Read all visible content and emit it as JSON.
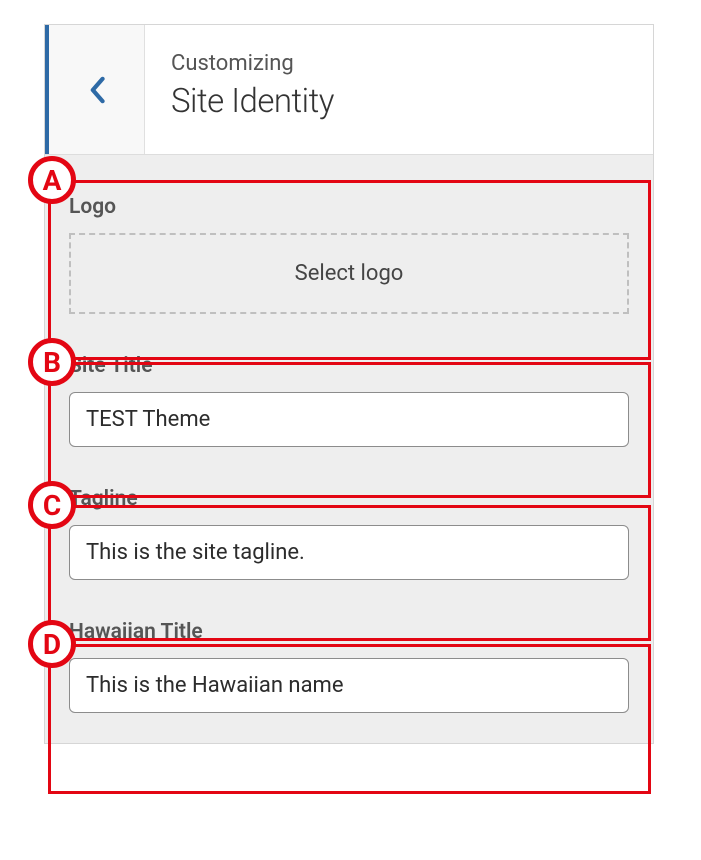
{
  "header": {
    "context_label": "Customizing",
    "section_title": "Site Identity"
  },
  "logo": {
    "label": "Logo",
    "button_text": "Select logo"
  },
  "site_title": {
    "label": "Site Title",
    "value": "TEST Theme"
  },
  "tagline": {
    "label": "Tagline",
    "value": "This is the site tagline."
  },
  "hawaiian_title": {
    "label": "Hawaiian Title",
    "value": "This is the Hawaiian name"
  },
  "annotations": {
    "a": "A",
    "b": "B",
    "c": "C",
    "d": "D"
  },
  "colors": {
    "accent": "#2e6aa6",
    "annotation": "#e30613"
  }
}
